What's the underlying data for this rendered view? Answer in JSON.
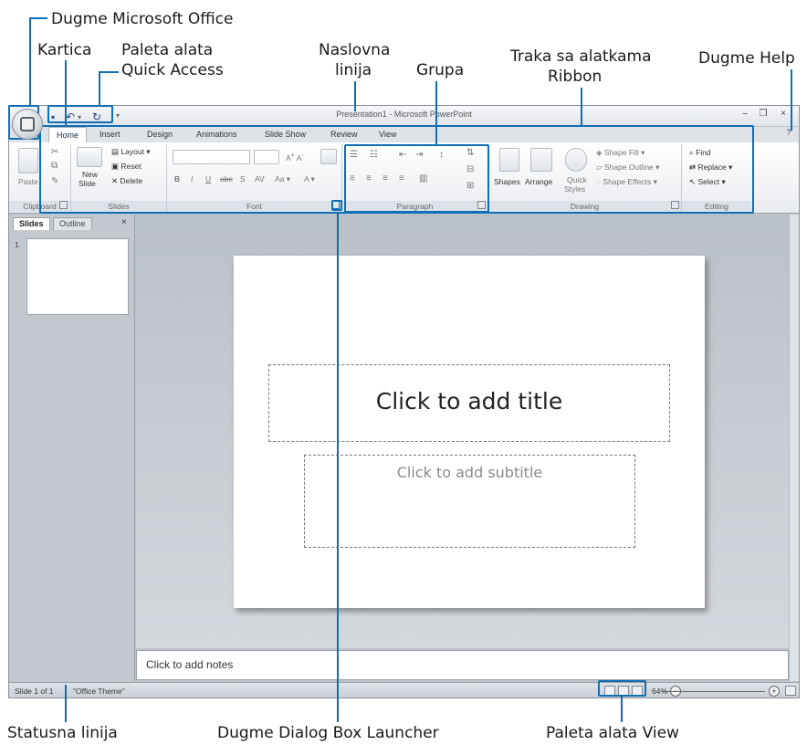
{
  "annotations": {
    "office_button": "Dugme Microsoft Office",
    "tab": "Kartica",
    "qat_line1": "Paleta alata",
    "qat_line2": "Quick Access",
    "titlebar_line1": "Naslovna",
    "titlebar_line2": "linija",
    "group": "Grupa",
    "ribbon_line1": "Traka sa alatkama",
    "ribbon_line2": "Ribbon",
    "help": "Dugme Help",
    "statusbar": "Statusna linija",
    "launcher": "Dugme Dialog Box Launcher",
    "view_toolbar": "Paleta alata View"
  },
  "window": {
    "title": "Presentation1 - Microsoft PowerPoint"
  },
  "tabs": [
    "Home",
    "Insert",
    "Design",
    "Animations",
    "Slide Show",
    "Review",
    "View"
  ],
  "ribbon": {
    "groups": {
      "clipboard": "Clipboard",
      "slides": "Slides",
      "font": "Font",
      "paragraph": "Paragraph",
      "drawing": "Drawing",
      "editing": "Editing"
    },
    "paste": "Paste",
    "new_slide_line1": "New",
    "new_slide_line2": "Slide",
    "layout": "Layout",
    "reset": "Reset",
    "delete": "Delete",
    "shapes": "Shapes",
    "arrange": "Arrange",
    "quick_line1": "Quick",
    "quick_line2": "Styles",
    "shape_fill": "Shape Fill",
    "shape_outline": "Shape Outline",
    "shape_effects": "Shape Effects",
    "find": "Find",
    "replace": "Replace",
    "select": "Select"
  },
  "pane": {
    "tab_slides": "Slides",
    "tab_outline": "Outline",
    "close": "×",
    "slide_number": "1"
  },
  "slide": {
    "title_placeholder": "Click to add title",
    "subtitle_placeholder": "Click to add subtitle"
  },
  "notes": {
    "placeholder": "Click to add notes"
  },
  "status": {
    "slide": "Slide 1 of 1",
    "theme": "\"Office Theme\"",
    "zoom": "64%"
  }
}
